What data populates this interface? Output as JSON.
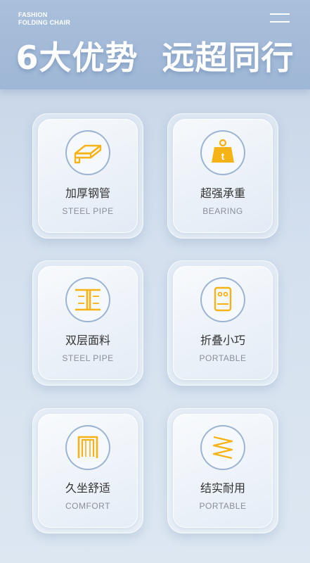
{
  "brand": {
    "line1": "FASHION",
    "line2": "FOLDING CHAIR"
  },
  "headline": "6大优势  远超同行",
  "accent_color": "#f5b316",
  "features": [
    {
      "title": "加厚钢管",
      "subtitle": "STEEL PIPE",
      "icon": "steel-pipe-icon"
    },
    {
      "title": "超强承重",
      "subtitle": "BEARING",
      "icon": "weight-icon"
    },
    {
      "title": "双层面料",
      "subtitle": "STEEL PIPE",
      "icon": "double-layer-icon"
    },
    {
      "title": "折叠小巧",
      "subtitle": "PORTABLE",
      "icon": "folding-icon"
    },
    {
      "title": "久坐舒适",
      "subtitle": "COMFORT",
      "icon": "chair-frame-icon"
    },
    {
      "title": "结实耐用",
      "subtitle": "PORTABLE",
      "icon": "spring-icon"
    }
  ]
}
